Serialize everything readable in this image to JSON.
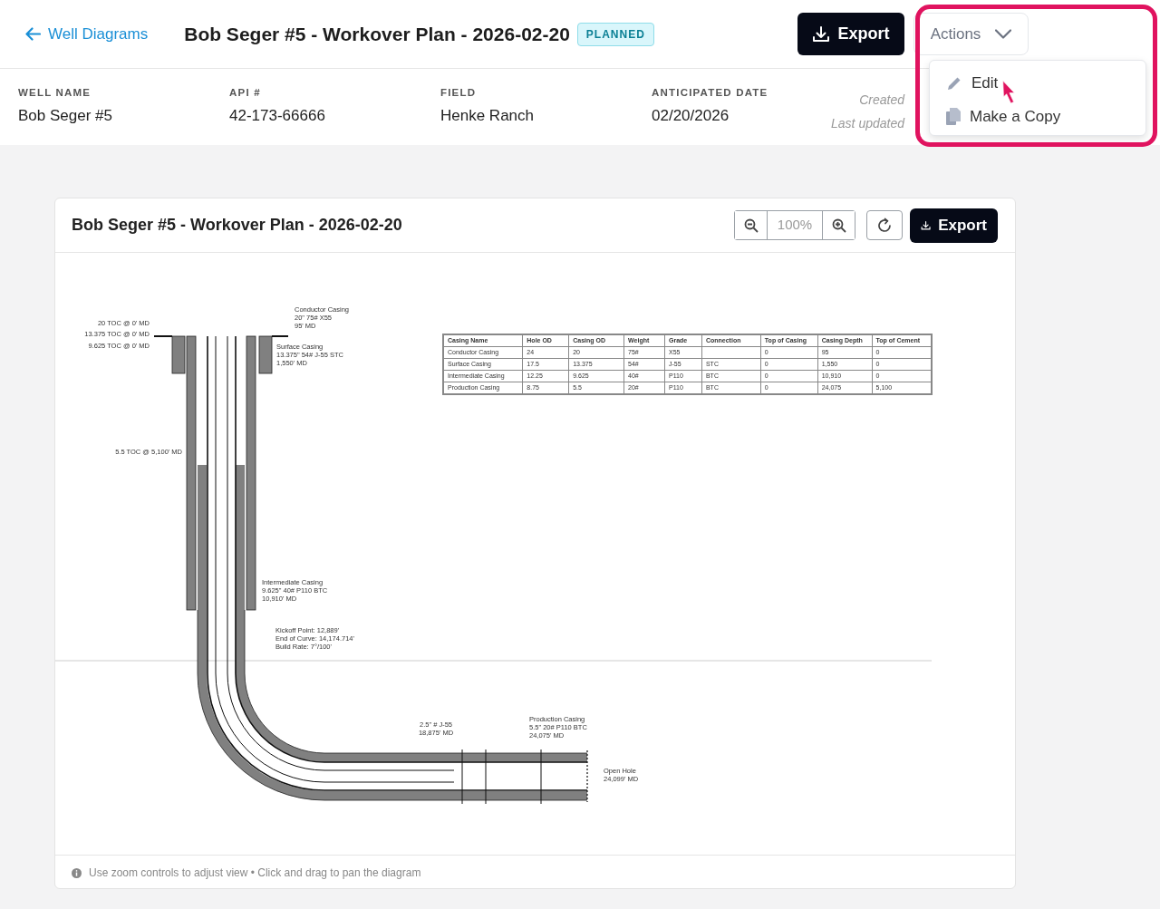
{
  "header": {
    "back_link": "Well Diagrams",
    "title": "Bob Seger #5 - Workover Plan - 2026-02-20",
    "status_badge": "PLANNED",
    "export_button": "Export",
    "actions_button": "Actions",
    "actions_menu": {
      "expanded": true,
      "items": [
        {
          "label": "Edit",
          "kind": "edit"
        },
        {
          "label": "Make a Copy",
          "kind": "copy"
        }
      ]
    }
  },
  "info_fields": [
    {
      "label": "WELL NAME",
      "value": "Bob Seger #5"
    },
    {
      "label": "API #",
      "value": "42-173-66666"
    },
    {
      "label": "FIELD",
      "value": "Henke Ranch"
    },
    {
      "label": "ANTICIPATED DATE",
      "value": "02/20/2026"
    }
  ],
  "meta": [
    "Created",
    "Last updated"
  ],
  "diagram_card": {
    "title": "Bob Seger #5 - Workover Plan - 2026-02-20",
    "zoom_level_text": "100%",
    "export_button": "Export",
    "annotations": [
      {
        "lines": [
          "20 TOC @ 0' MD"
        ]
      },
      {
        "lines": [
          "13.375 TOC @ 0' MD"
        ]
      },
      {
        "lines": [
          "9.625 TOC @ 0' MD"
        ]
      },
      {
        "lines": [
          "Conductor Casing",
          "20\" 75# X55",
          "95' MD"
        ]
      },
      {
        "lines": [
          "Surface Casing",
          "13.375\" 54# J-55 STC",
          "1,550' MD"
        ]
      },
      {
        "lines": [
          "5.5 TOC @ 5,100' MD"
        ]
      },
      {
        "lines": [
          "Intermediate Casing",
          "9.625\" 40# P110 BTC",
          "10,910' MD"
        ]
      },
      {
        "lines": [
          "Kickoff Point: 12,889'",
          "End of Curve: 14,174.714'",
          "Build Rate: 7°/100'"
        ]
      },
      {
        "lines": [
          "2.5\" # J-55",
          "18,875' MD"
        ]
      },
      {
        "lines": [
          "Production Casing",
          "5.5\" 20# P110 BTC",
          "24,075' MD"
        ]
      },
      {
        "lines": [
          "Open Hole",
          "24,099' MD"
        ]
      }
    ],
    "casing_table": {
      "columns": [
        "Casing Name",
        "Hole OD",
        "Casing OD",
        "Weight",
        "Grade",
        "Connection",
        "Top of Casing",
        "Casing Depth",
        "Top of Cement"
      ],
      "rows": [
        [
          "Conductor Casing",
          "24",
          "20",
          "75#",
          "X55",
          "",
          "0",
          "95",
          "0"
        ],
        [
          "Surface Casing",
          "17.5",
          "13.375",
          "54#",
          "J-55",
          "STC",
          "0",
          "1,550",
          "0"
        ],
        [
          "Intermediate Casing",
          "12.25",
          "9.625",
          "40#",
          "P110",
          "BTC",
          "0",
          "10,910",
          "0"
        ],
        [
          "Production Casing",
          "8.75",
          "5.5",
          "20#",
          "P110",
          "BTC",
          "0",
          "24,075",
          "5,100"
        ]
      ]
    },
    "hint": "Use zoom controls to adjust view • Click and drag to pan the diagram"
  }
}
